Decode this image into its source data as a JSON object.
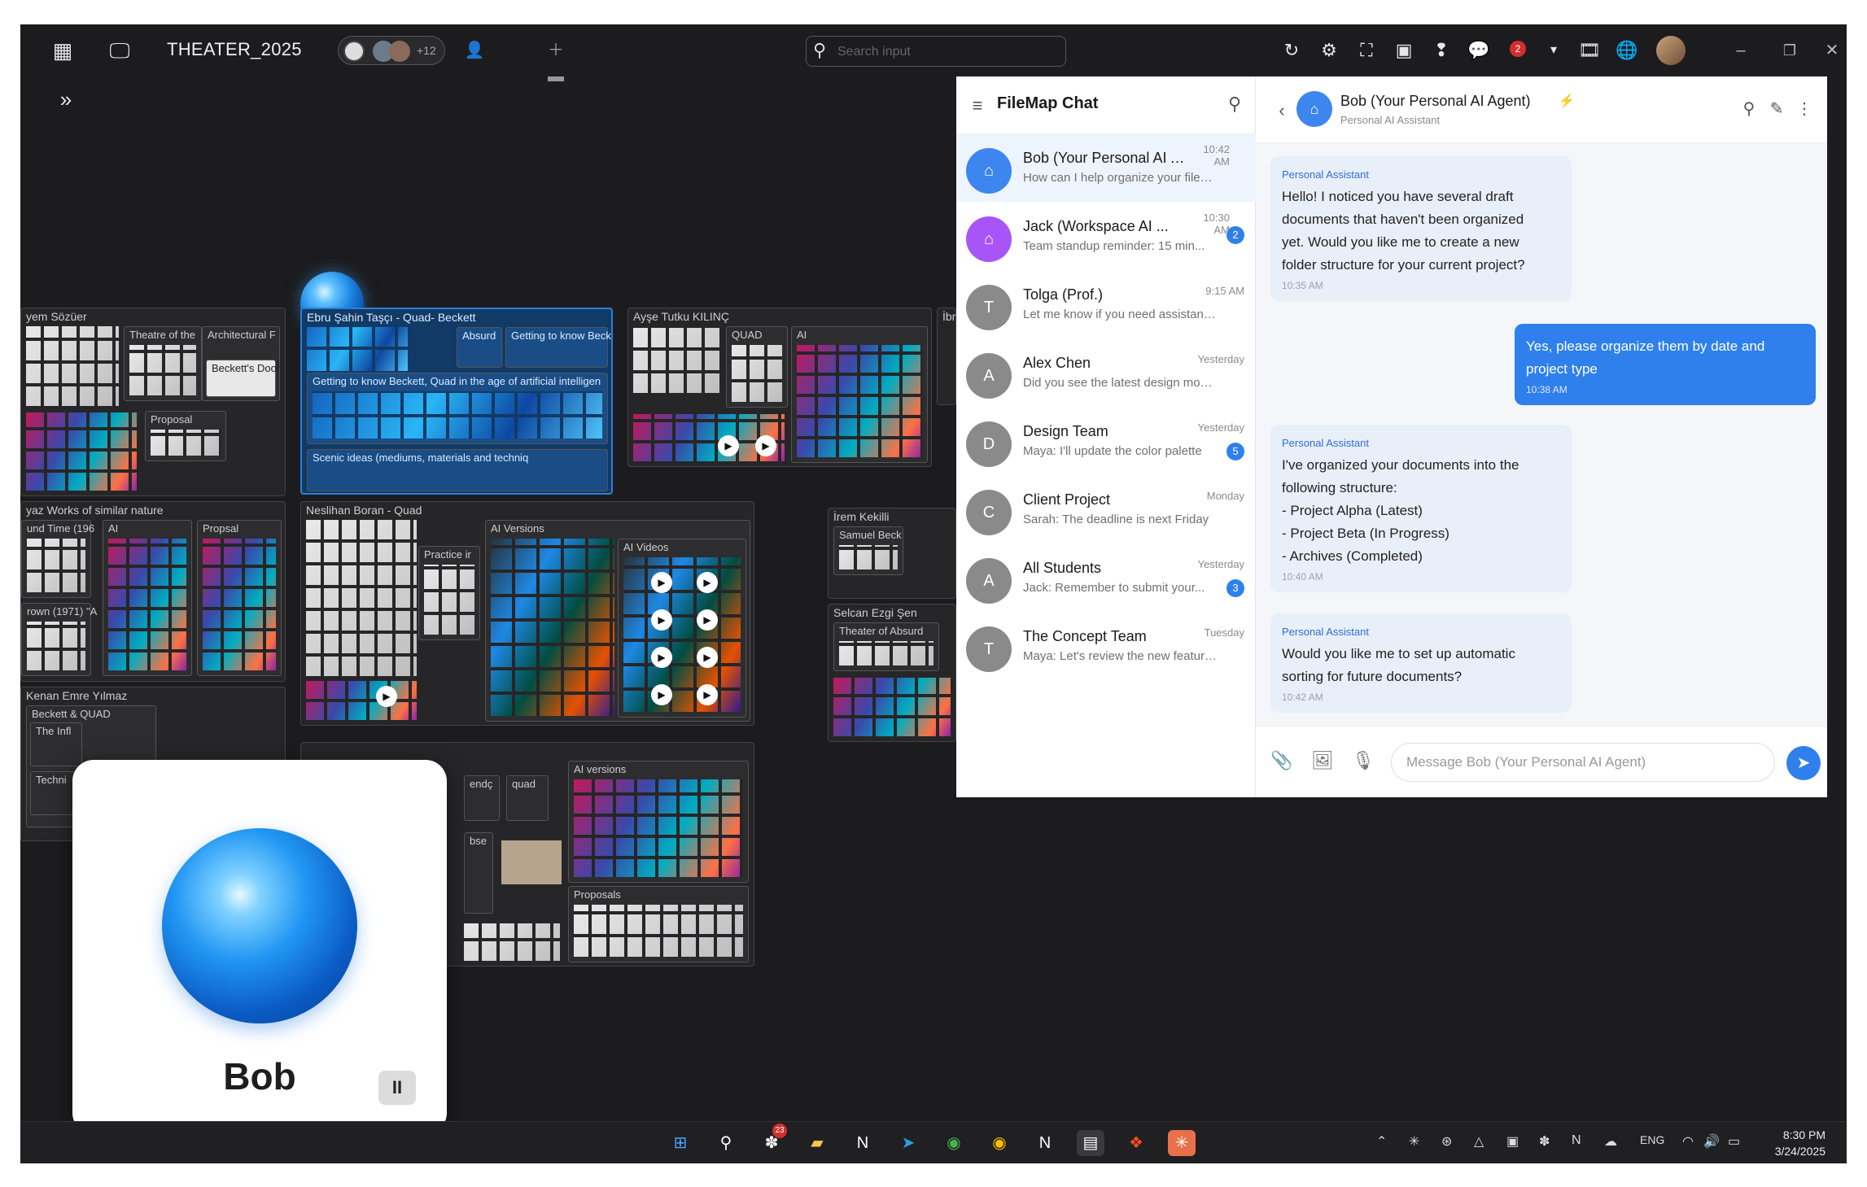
{
  "app": {
    "workspace_title": "THEATER_2025",
    "collaborators_extra": "+12",
    "search_placeholder": "Search input",
    "notification_count": "2"
  },
  "canvas": {
    "boards": [
      {
        "title": "yem Sözüer"
      },
      {
        "title": "Ebru Şahin Taşçı - Quad- Beckett"
      },
      {
        "title": "Ayşe Tutku KILINÇ"
      },
      {
        "title": "Neslihan Boran - Quad"
      },
      {
        "title": "İrem Kekilli"
      },
      {
        "title": "Selcan Ezgi Şen"
      },
      {
        "title": "Kenan Emre Yılmaz"
      }
    ],
    "subboards": {
      "theatre": "Theatre of the",
      "architectural": "Architectural F",
      "becketts_door": "Beckett's Door",
      "proposal": "Proposal",
      "works_similar": "yaz Works of similar nature",
      "ai": "AI",
      "propsal": "Propsal",
      "und_time": "und Time (196",
      "rown": "rown (1971) \"A",
      "absurd": "Absurd",
      "getting_to_know": "Getting to know Beck",
      "getting_quad": "Getting to know Beckett, Quad in the age of artificial intelligen",
      "scenic": "Scenic ideas (mediums, materials and techniq",
      "quad": "QUAD",
      "ai2": "AI",
      "ai_versions": "AI Versions",
      "ai_videos": "AI Videos",
      "practice": "Practice ir",
      "samuel": "Samuel Beck",
      "theater_absurd": "Theater of Absurd",
      "beckett_quad": "Beckett & QUAD",
      "the_inf": "The Infl",
      "techni": "Techni",
      "endc": "endç",
      "quad_small": "quad",
      "ai_versions2": "AI versions",
      "proposals": "Proposals",
      "ibra": "İbra",
      "bse": "bse"
    }
  },
  "bob_card": {
    "name": "Bob",
    "pause_label": "II"
  },
  "chat": {
    "list_title": "FileMap Chat",
    "conversations": [
      {
        "name": "Bob (Your Personal AI A...",
        "time": "10:42 AM",
        "preview": "How can I help organize your files t...",
        "avatar": "",
        "badge": ""
      },
      {
        "name": "Jack (Workspace AI ...",
        "time": "10:30 AM",
        "preview": "Team standup reminder: 15 min...",
        "avatar": "",
        "badge": "2"
      },
      {
        "name": "Tolga (Prof.)",
        "time": "9:15 AM",
        "preview": "Let me know if you need assistance ...",
        "avatar": "T",
        "badge": ""
      },
      {
        "name": "Alex Chen",
        "time": "Yesterday",
        "preview": "Did you see the latest design mocku...",
        "avatar": "A",
        "badge": ""
      },
      {
        "name": "Design Team",
        "time": "Yesterday",
        "preview": "Maya: I'll update the color palette",
        "avatar": "D",
        "badge": "5"
      },
      {
        "name": "Client Project",
        "time": "Monday",
        "preview": "Sarah: The deadline is next Friday",
        "avatar": "C",
        "badge": ""
      },
      {
        "name": "All Students",
        "time": "Yesterday",
        "preview": "Jack: Remember to submit your...",
        "avatar": "A",
        "badge": "3"
      },
      {
        "name": "The Concept Team",
        "time": "Tuesday",
        "preview": "Maya: Let's review the new feature i...",
        "avatar": "T",
        "badge": ""
      }
    ],
    "header": {
      "name": "Bob (Your Personal AI Agent)",
      "subtitle": "Personal AI Assistant"
    },
    "messages": [
      {
        "tag": "Personal Assistant",
        "text": "Hello! I noticed you have several draft\ndocuments that haven't been organized\nyet. Would you like me to create a new\nfolder structure for your current project?",
        "time": "10:35 AM"
      },
      {
        "tag": "",
        "text": "Yes, please organize them by date and\nproject type",
        "time": "10:38 AM"
      },
      {
        "tag": "Personal Assistant",
        "text": "I've organized your documents into the\nfollowing structure:\n- Project Alpha (Latest)\n- Project Beta (In Progress)\n- Archives (Completed)",
        "time": "10:40 AM"
      },
      {
        "tag": "Personal Assistant",
        "text": "Would you like me to set up automatic\nsorting for future documents?",
        "time": "10:42 AM"
      }
    ],
    "composer_placeholder": "Message Bob (Your Personal AI Agent)"
  },
  "taskbar": {
    "notion_badge": "23",
    "language": "ENG",
    "time": "8:30 PM",
    "date": "3/24/2025"
  }
}
